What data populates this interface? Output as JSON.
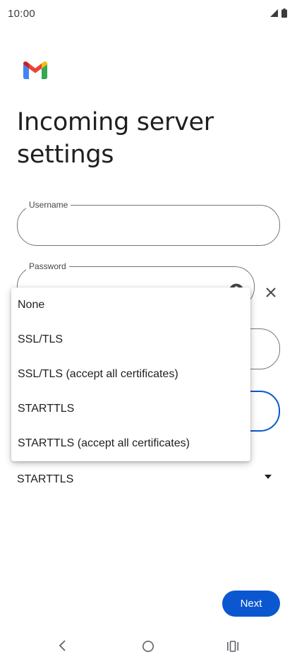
{
  "status_bar": {
    "time": "10:00",
    "icons": [
      "signal-icon",
      "battery-icon"
    ]
  },
  "app": {
    "logo": "gmail-logo"
  },
  "header": {
    "title": "Incoming server settings"
  },
  "form": {
    "username": {
      "label": "Username",
      "value": ""
    },
    "password": {
      "label": "Password",
      "value": ""
    },
    "server": {
      "value": ""
    },
    "port": {
      "value": ""
    },
    "security": {
      "selected": "STARTTLS"
    }
  },
  "dropdown": {
    "options": [
      "None",
      "SSL/TLS",
      "SSL/TLS (accept all certificates)",
      "STARTTLS",
      "STARTTLS (accept all certificates)"
    ]
  },
  "actions": {
    "next_label": "Next"
  },
  "nav_bar": {
    "icons": [
      "back-icon",
      "home-icon",
      "recents-icon"
    ]
  },
  "colors": {
    "accent": "#0b57d0",
    "text": "#1f1f1f",
    "outline": "#747775",
    "gmail_red": "#ea4335",
    "gmail_blue": "#4285f4",
    "gmail_green": "#34a853",
    "gmail_yellow": "#fbbc04"
  }
}
